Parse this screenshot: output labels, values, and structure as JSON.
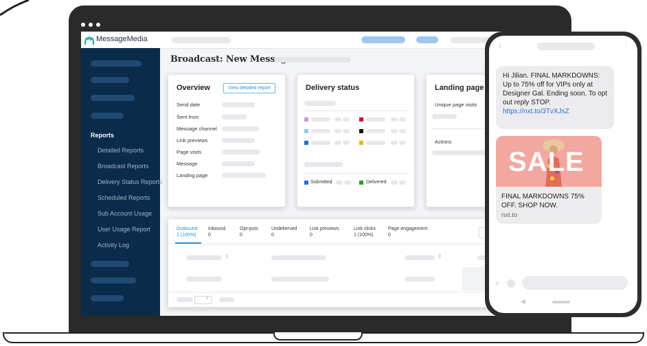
{
  "app": {
    "logo_text": "MessageMedia"
  },
  "page": {
    "title": "Broadcast: New Message"
  },
  "sidebar": {
    "section_title": "Reports",
    "items": [
      {
        "label": "Detailed Reports"
      },
      {
        "label": "Broadcast Reports"
      },
      {
        "label": "Delivery Status Reports"
      },
      {
        "label": "Scheduled Reports"
      },
      {
        "label": "Sub Account Usage"
      },
      {
        "label": "User Usage Report"
      },
      {
        "label": "Activity Log"
      }
    ]
  },
  "overview": {
    "title": "Overview",
    "button_label": "View detailed report",
    "fields": [
      "Send date",
      "Sent from",
      "Message channel",
      "Link previews",
      "Page visits",
      "Message",
      "Landing page"
    ]
  },
  "delivery": {
    "title": "Delivery status",
    "legend_submitted": "Submitted",
    "legend_delivered": "Delivered",
    "colors": {
      "purple": "#c79ae8",
      "red": "#c0172f",
      "cyan": "#8ecfe6",
      "black": "#111111",
      "blue": "#1f6fd1",
      "yellow": "#f0b300",
      "green": "#2e9a2e"
    }
  },
  "landing": {
    "title": "Landing page en",
    "unique_visits": "Unique page visits",
    "actions": "Actions"
  },
  "tabs": [
    {
      "label": "Outbound",
      "value": "1 (100%)"
    },
    {
      "label": "Inbound",
      "value": "0"
    },
    {
      "label": "Opt-puts",
      "value": "0"
    },
    {
      "label": "Undelierved",
      "value": "0"
    },
    {
      "label": "Link previews",
      "value": "0"
    },
    {
      "label": "Link clicks",
      "value": "1 (100%)"
    },
    {
      "label": "Page engagement",
      "value": "0"
    }
  ],
  "phone": {
    "message_text": "Hi Jilian. FINAL MARKDOWNS: Up to 75% off for VIPs only at Designer Gal. Ending soon. To opt out reply STOP.",
    "message_link": "https://nxt.to/3TvXJsZ",
    "sale_text": "SALE",
    "card_title": "FINAL MARKDOWNS 75% OFF. SHOP NOW.",
    "card_domain": "nxt.to"
  }
}
